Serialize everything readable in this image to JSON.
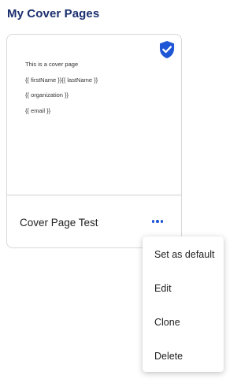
{
  "header": {
    "title": "My Cover Pages"
  },
  "card": {
    "preview_lines": [
      "This is a cover page",
      "{{ firstName }}{{ lastName }}",
      "{{ organization }}",
      "{{ email }}"
    ],
    "name": "Cover Page Test",
    "default_icon": "shield-check-icon",
    "more_icon": "more-horizontal-icon"
  },
  "menu": {
    "items": [
      {
        "label": "Set as default"
      },
      {
        "label": "Edit"
      },
      {
        "label": "Clone"
      },
      {
        "label": "Delete"
      }
    ]
  },
  "colors": {
    "title": "#1b2e6e",
    "accent": "#1f56d6"
  }
}
